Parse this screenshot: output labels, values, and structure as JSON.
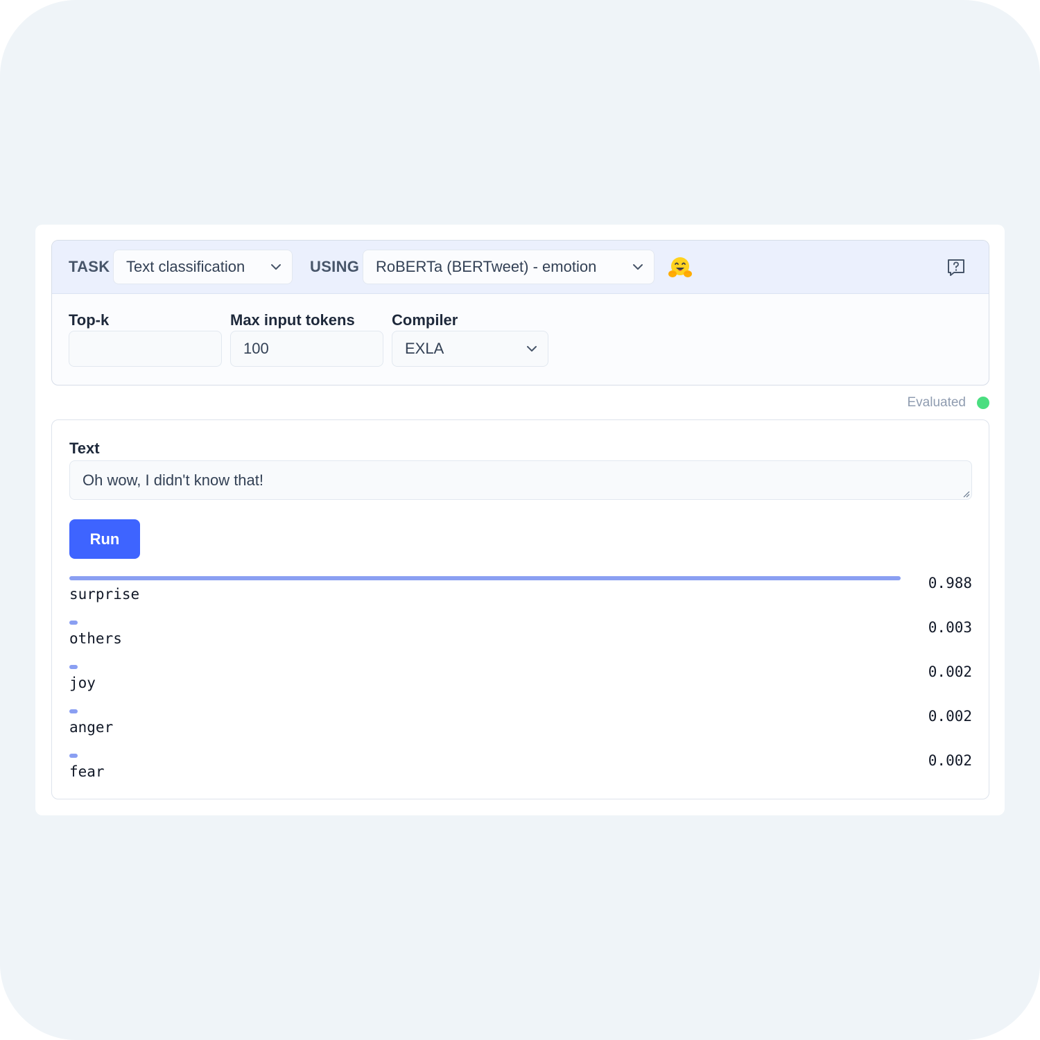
{
  "header": {
    "task_label": "TASK",
    "task_value": "Text classification",
    "using_label": "USING",
    "model_value": "RoBERTa (BERTweet) - emotion",
    "hub_icon": "hugging-face-emoji-icon",
    "help_icon": "help-message-icon"
  },
  "fields": {
    "topk_label": "Top-k",
    "topk_value": "",
    "max_tokens_label": "Max input tokens",
    "max_tokens_value": "100",
    "compiler_label": "Compiler",
    "compiler_value": "EXLA"
  },
  "status": {
    "text": "Evaluated",
    "color": "#4ade80"
  },
  "input": {
    "label": "Text",
    "value": "Oh wow, I didn't know that!"
  },
  "run_label": "Run",
  "results": [
    {
      "label": "surprise",
      "score": "0.988",
      "value": 0.988
    },
    {
      "label": "others",
      "score": "0.003",
      "value": 0.003
    },
    {
      "label": "joy",
      "score": "0.002",
      "value": 0.002
    },
    {
      "label": "anger",
      "score": "0.002",
      "value": 0.002
    },
    {
      "label": "fear",
      "score": "0.002",
      "value": 0.002
    }
  ],
  "colors": {
    "accent": "#3e64ff",
    "bar": "#8a9ff2",
    "header_bg": "#ebf0fd"
  }
}
